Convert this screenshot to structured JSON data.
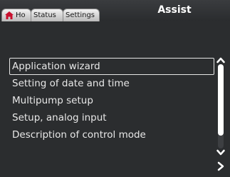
{
  "header": {
    "title": "Assist",
    "tabs": [
      {
        "label": "Ho",
        "icon": "home-icon"
      },
      {
        "label": "Status"
      },
      {
        "label": "Settings"
      }
    ]
  },
  "menu": {
    "items": [
      {
        "label": "Application wizard",
        "selected": true
      },
      {
        "label": "Setting of date and time"
      },
      {
        "label": "Multipump setup"
      },
      {
        "label": "Setup, analog input"
      },
      {
        "label": "Description of control mode"
      }
    ]
  },
  "scrollbar": {
    "up_icon": "chevron-up-icon",
    "down_icon": "chevron-down-icon"
  },
  "navigation": {
    "next_icon": "chevron-right-icon"
  },
  "colors": {
    "background": "#2b2d2f",
    "text": "#e8e8e8",
    "selection_border": "#e6e6e6",
    "tab_fill": "#d9d9d9"
  }
}
